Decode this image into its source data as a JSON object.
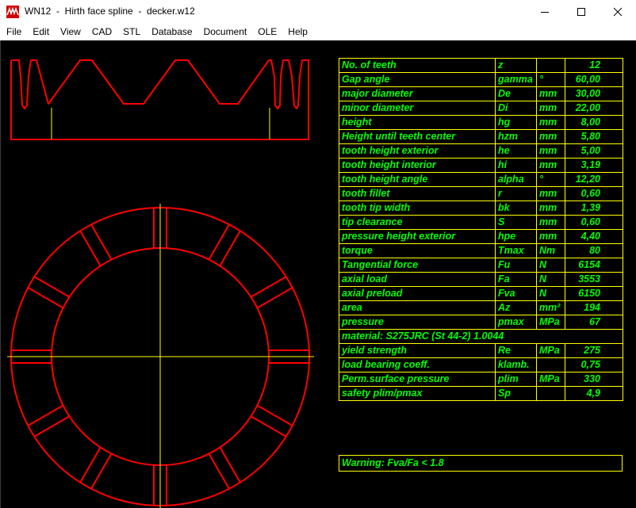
{
  "window": {
    "app_name": "WN12",
    "title": "WN12  -  Hirth face spline  -  decker.w12",
    "icon": "wn12-app-icon"
  },
  "menu": [
    {
      "label": "File",
      "key": "file"
    },
    {
      "label": "Edit",
      "key": "edit"
    },
    {
      "label": "View",
      "key": "view"
    },
    {
      "label": "CAD",
      "key": "cad"
    },
    {
      "label": "STL",
      "key": "stl"
    },
    {
      "label": "Database",
      "key": "database"
    },
    {
      "label": "Document",
      "key": "document"
    },
    {
      "label": "OLE",
      "key": "ole"
    },
    {
      "label": "Help",
      "key": "help"
    }
  ],
  "colors": {
    "drawing": "#ff0000",
    "centerline": "#ffff00",
    "table_text": "#00ff00",
    "table_border": "#ffff00",
    "background": "#000000"
  },
  "params": {
    "r0": {
      "label": "No. of teeth",
      "sym": "z",
      "unit": "",
      "value": "12"
    },
    "r1": {
      "label": "Gap angle",
      "sym": "gamma",
      "unit": "°",
      "value": "60,00"
    },
    "r2": {
      "label": "major diameter",
      "sym": "De",
      "unit": "mm",
      "value": "30,00"
    },
    "r3": {
      "label": "minor diameter",
      "sym": "Di",
      "unit": "mm",
      "value": "22,00"
    },
    "r4": {
      "label": "height",
      "sym": "hg",
      "unit": "mm",
      "value": "8,00"
    },
    "r5": {
      "label": "Height until teeth center",
      "sym": "hzm",
      "unit": "mm",
      "value": "5,80"
    },
    "r6": {
      "label": "tooth height exterior",
      "sym": "he",
      "unit": "mm",
      "value": "5,00"
    },
    "r7": {
      "label": "tooth height interior",
      "sym": "hi",
      "unit": "mm",
      "value": "3,19"
    },
    "r8": {
      "label": "tooth height angle",
      "sym": "alpha",
      "unit": "°",
      "value": "12,20"
    },
    "r9": {
      "label": "tooth fillet",
      "sym": "r",
      "unit": "mm",
      "value": "0,60"
    },
    "r10": {
      "label": "tooth tip width",
      "sym": "bk",
      "unit": "mm",
      "value": "1,39"
    },
    "r11": {
      "label": "tip clearance",
      "sym": "S",
      "unit": "mm",
      "value": "0,60"
    },
    "r12": {
      "label": "pressure height exterior",
      "sym": "hpe",
      "unit": "mm",
      "value": "4,40"
    },
    "r13": {
      "label": "torque",
      "sym": "Tmax",
      "unit": "Nm",
      "value": "80"
    },
    "r14": {
      "label": "Tangential force",
      "sym": "Fu",
      "unit": "N",
      "value": "6154"
    },
    "r15": {
      "label": "axial load",
      "sym": "Fa",
      "unit": "N",
      "value": "3553"
    },
    "r16": {
      "label": "axial preload",
      "sym": "Fva",
      "unit": "N",
      "value": "6150"
    },
    "r17": {
      "label": "area",
      "sym": "Az",
      "unit": "mm²",
      "value": "194"
    },
    "r18": {
      "label": "pressure",
      "sym": "pmax",
      "unit": "MPa",
      "value": "67"
    },
    "material": "material: S275JRC (St 44-2)   1.0044",
    "r19": {
      "label": "yield strength",
      "sym": "Re",
      "unit": "MPa",
      "value": "275"
    },
    "r20": {
      "label": "load bearing coeff.",
      "sym": "klamb.",
      "unit": "",
      "value": "0,75"
    },
    "r21": {
      "label": "Perm.surface pressure",
      "sym": "plim",
      "unit": "MPa",
      "value": "330"
    },
    "r22": {
      "label": "safety plim/pmax",
      "sym": "Sp",
      "unit": "",
      "value": "4,9"
    }
  },
  "warning": "Warning: Fva/Fa < 1.8"
}
